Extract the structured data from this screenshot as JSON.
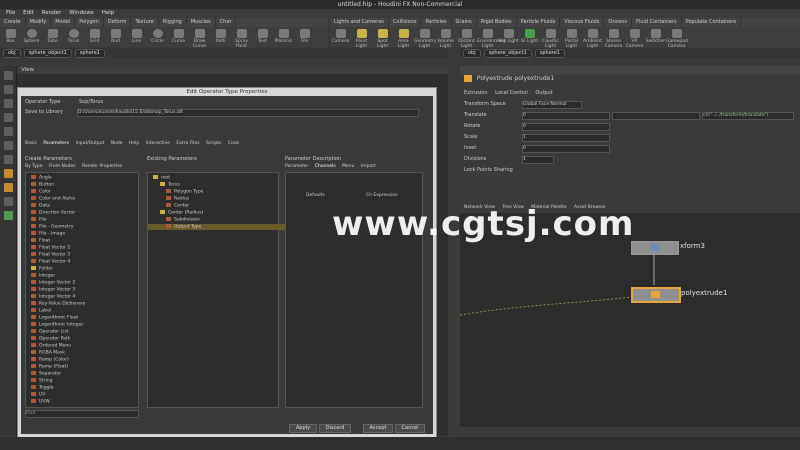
{
  "window": {
    "title": "untitled.hip - Houdini FX Non-Commercial"
  },
  "menu": [
    "File",
    "Edit",
    "Render",
    "Windows",
    "Help"
  ],
  "shelf_tabs_left": [
    "Create",
    "Modify",
    "Model",
    "Polygon",
    "Deform",
    "Texture",
    "Rigging",
    "Muscles",
    "Char",
    "Guide Process",
    "Guide Brushes",
    "Terrain FX",
    "Cloud FX",
    "Volume"
  ],
  "shelf_tools_left": [
    "Box",
    "Sphere",
    "Tube",
    "Torus",
    "Grid",
    "Null",
    "Line",
    "Circle",
    "Curve",
    "Draw Curve",
    "Path",
    "Spray Paint",
    "Text",
    "Platonic",
    "L-System",
    "Metaball",
    "File"
  ],
  "shelf_tabs_right": [
    "Lights and Cameras",
    "Collisions",
    "Particles",
    "Grains",
    "Rigid Bodies",
    "Particle Fluids",
    "Viscous Fluids",
    "Oceans",
    "Fluid Containers",
    "Populate Containers",
    "Container Tools",
    "Pyro FX",
    "Cloth",
    "Solid",
    "Wires",
    "Crowds",
    "Drive Simulation"
  ],
  "shelf_tools_right": [
    "Camera",
    "Point Light",
    "Spot Light",
    "Area Light",
    "Geometry Light",
    "Volume Light",
    "Distant Light",
    "Environment Light",
    "Sky Light",
    "GI Light",
    "Caustic Light",
    "Portal Light",
    "Ambient Light",
    "Stereo Camera",
    "VR Camera",
    "Switcher",
    "Gamepad Camera"
  ],
  "path_left": {
    "obj": "obj",
    "node": "sphere_object1",
    "geo": "sphere1"
  },
  "path_right": {
    "obj": "obj",
    "node": "sphere_object1",
    "geo": "sphere1"
  },
  "viewport_label": "View",
  "dialog": {
    "title": "Edit Operator Type Properties",
    "operator_type_label": "Operator Type",
    "operator_type_value": "Sop/Torus",
    "save_library_label": "Save to Library",
    "save_library_value": "D:/Users/xuanm/houdini15.0/otls/sop_Torus.otl",
    "tabs": [
      "Basic",
      "Parameters",
      "Input/Output",
      "Node",
      "Help",
      "Interactive",
      "Extra Files",
      "Scripts",
      "Cook"
    ],
    "create_params_title": "Create Parameters",
    "create_params_tabs": [
      "By Type",
      "From Nodes",
      "Render Properties"
    ],
    "param_types": [
      "Angle",
      "Button",
      "Color",
      "Color and Alpha",
      "Data",
      "Direction Vector",
      "File",
      "File - Geometry",
      "File - Image",
      "Float",
      "Float Vector 2",
      "Float Vector 3",
      "Float Vector 4",
      "Folder",
      "Integer",
      "Integer Vector 2",
      "Integer Vector 3",
      "Integer Vector 4",
      "Key-Value Dictionary",
      "Label",
      "Logarithmic Float",
      "Logarithmic Integer",
      "Operator List",
      "Operator Path",
      "Ordered Menu",
      "RGBA Mask",
      "Ramp (Color)",
      "Ramp (Float)",
      "Separator",
      "String",
      "Toggle",
      "UV",
      "UVW"
    ],
    "existing_params_title": "Existing Parameters",
    "existing_tree": [
      "root",
      "Torus",
      "Polygon Type",
      "Radius",
      "Center",
      "Center (Radius)",
      "Subdivision",
      "Output Type"
    ],
    "param_desc_title": "Parameter Description",
    "param_desc_tabs": [
      "Parameter",
      "Channels",
      "Menu",
      "Import"
    ],
    "channels_header": [
      "Defaults",
      "Ch Expression"
    ],
    "footer_buttons": [
      "Apply",
      "Discard",
      "Accept",
      "Cancel"
    ],
    "search_placeholder": "Find"
  },
  "params_panel": {
    "node_title": "Polyextrude  polyextrude1",
    "tabs": [
      "Extrusion",
      "Local Control",
      "Output"
    ],
    "rows": [
      {
        "label": "Transform Space",
        "value": "Global Face Normal"
      },
      {
        "label": "Translate",
        "value": "0"
      },
      {
        "label": "Rotate",
        "value": "0"
      },
      {
        "label": "Scale",
        "value": "1"
      },
      {
        "label": "Inset",
        "value": "0"
      },
      {
        "label": "Divisions",
        "value": "1"
      },
      {
        "label": "Lock Points Sharing",
        "value": ""
      }
    ],
    "expr_value": "ch(\"../../transform/translate\")"
  },
  "network": {
    "tabs": [
      "Network View",
      "Tree View",
      "Material Palette",
      "Asset Browser"
    ],
    "nodes": [
      {
        "name": "xform3"
      },
      {
        "name": "polyextrude1"
      }
    ]
  },
  "watermark": "www.cgtsj.com",
  "colors": {
    "accent": "#e8a33a",
    "node": "#8f8f8f",
    "dialog_bg": "#3a3a3a"
  }
}
